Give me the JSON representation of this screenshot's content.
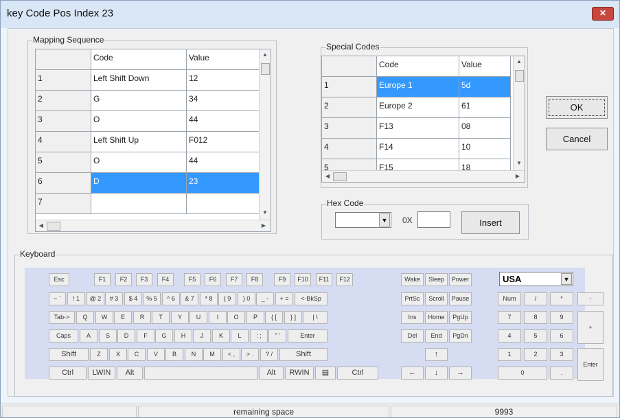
{
  "window": {
    "title": "key Code Pos Index 23",
    "close_glyph": "✕"
  },
  "mapping": {
    "legend": "Mapping Sequence",
    "headers": [
      "Code",
      "Value"
    ],
    "rows": [
      {
        "n": "1",
        "code": "Left Shift Down",
        "value": "12"
      },
      {
        "n": "2",
        "code": "G",
        "value": "34"
      },
      {
        "n": "3",
        "code": "O",
        "value": "44"
      },
      {
        "n": "4",
        "code": "Left Shift Up",
        "value": "F012"
      },
      {
        "n": "5",
        "code": "O",
        "value": "44"
      },
      {
        "n": "6",
        "code": "D",
        "value": "23"
      },
      {
        "n": "7",
        "code": "",
        "value": ""
      }
    ],
    "selected_row": 5
  },
  "special": {
    "legend": "Special Codes",
    "headers": [
      "Code",
      "Value"
    ],
    "rows": [
      {
        "n": "1",
        "code": "Europe 1",
        "value": "5d"
      },
      {
        "n": "2",
        "code": "Europe 2",
        "value": "61"
      },
      {
        "n": "3",
        "code": "F13",
        "value": "08"
      },
      {
        "n": "4",
        "code": "F14",
        "value": "10"
      },
      {
        "n": "5",
        "code": "F15",
        "value": "18"
      }
    ],
    "selected_row": 0
  },
  "buttons": {
    "ok": "OK",
    "cancel": "Cancel",
    "insert": "Insert"
  },
  "hex": {
    "legend": "Hex Code",
    "prefix": "0X",
    "combo_value": "",
    "field_value": ""
  },
  "keyboard": {
    "legend": "Keyboard",
    "layout_value": "USA",
    "keys": [
      {
        "id": "esc",
        "label": "Esc"
      },
      {
        "id": "f1",
        "label": "F1"
      },
      {
        "id": "f2",
        "label": "F2"
      },
      {
        "id": "f3",
        "label": "F3"
      },
      {
        "id": "f4",
        "label": "F4"
      },
      {
        "id": "f5",
        "label": "F5"
      },
      {
        "id": "f6",
        "label": "F6"
      },
      {
        "id": "f7",
        "label": "F7"
      },
      {
        "id": "f8",
        "label": "F8"
      },
      {
        "id": "f9",
        "label": "F9"
      },
      {
        "id": "f10",
        "label": "F10"
      },
      {
        "id": "f11",
        "label": "F11"
      },
      {
        "id": "f12",
        "label": "F12"
      },
      {
        "id": "wake",
        "label": "Wake"
      },
      {
        "id": "sleep",
        "label": "Sleep"
      },
      {
        "id": "power",
        "label": "Power"
      },
      {
        "id": "tilde",
        "label": "~ `"
      },
      {
        "id": "k1",
        "label": "! 1"
      },
      {
        "id": "k2",
        "label": "@ 2"
      },
      {
        "id": "k3",
        "label": "# 3"
      },
      {
        "id": "k4",
        "label": "$ 4"
      },
      {
        "id": "k5",
        "label": "% 5"
      },
      {
        "id": "k6",
        "label": "^ 6"
      },
      {
        "id": "k7",
        "label": "& 7"
      },
      {
        "id": "k8",
        "label": "* 8"
      },
      {
        "id": "k9",
        "label": "( 9"
      },
      {
        "id": "k0",
        "label": ") 0"
      },
      {
        "id": "minus",
        "label": "_ -"
      },
      {
        "id": "equal",
        "label": "+ ="
      },
      {
        "id": "bksp",
        "label": "<-BkSp"
      },
      {
        "id": "prtsc",
        "label": "PrtSc"
      },
      {
        "id": "scroll",
        "label": "Scroll"
      },
      {
        "id": "pause",
        "label": "Pause"
      },
      {
        "id": "num",
        "label": "Num"
      },
      {
        "id": "ndiv",
        "label": "/"
      },
      {
        "id": "nmul",
        "label": "*"
      },
      {
        "id": "nminus",
        "label": "-"
      },
      {
        "id": "tab",
        "label": "Tab->"
      },
      {
        "id": "q",
        "label": "Q"
      },
      {
        "id": "w",
        "label": "W"
      },
      {
        "id": "e",
        "label": "E"
      },
      {
        "id": "r",
        "label": "R"
      },
      {
        "id": "t",
        "label": "T"
      },
      {
        "id": "y",
        "label": "Y"
      },
      {
        "id": "u",
        "label": "U"
      },
      {
        "id": "i",
        "label": "I"
      },
      {
        "id": "o",
        "label": "O"
      },
      {
        "id": "p",
        "label": "P"
      },
      {
        "id": "lbr",
        "label": "{ ["
      },
      {
        "id": "rbr",
        "label": "} ]"
      },
      {
        "id": "bsl",
        "label": "| \\"
      },
      {
        "id": "ins",
        "label": "Ins"
      },
      {
        "id": "home",
        "label": "Home"
      },
      {
        "id": "pgup",
        "label": "PgUp"
      },
      {
        "id": "n7",
        "label": "7"
      },
      {
        "id": "n8",
        "label": "8"
      },
      {
        "id": "n9",
        "label": "9"
      },
      {
        "id": "nplus",
        "label": "+"
      },
      {
        "id": "caps",
        "label": "Caps"
      },
      {
        "id": "a",
        "label": "A"
      },
      {
        "id": "s",
        "label": "S"
      },
      {
        "id": "d",
        "label": "D"
      },
      {
        "id": "f",
        "label": "F"
      },
      {
        "id": "g",
        "label": "G"
      },
      {
        "id": "h",
        "label": "H"
      },
      {
        "id": "j",
        "label": "J"
      },
      {
        "id": "k",
        "label": "K"
      },
      {
        "id": "l",
        "label": "L"
      },
      {
        "id": "semi",
        "label": ": ;"
      },
      {
        "id": "quote",
        "label": "\" '"
      },
      {
        "id": "enter",
        "label": "Enter"
      },
      {
        "id": "del",
        "label": "Del"
      },
      {
        "id": "end",
        "label": "End"
      },
      {
        "id": "pgdn",
        "label": "PgDn"
      },
      {
        "id": "n4",
        "label": "4"
      },
      {
        "id": "n5",
        "label": "5"
      },
      {
        "id": "n6",
        "label": "6"
      },
      {
        "id": "lshift",
        "label": "Shift"
      },
      {
        "id": "z",
        "label": "Z"
      },
      {
        "id": "x",
        "label": "X"
      },
      {
        "id": "c",
        "label": "C"
      },
      {
        "id": "v",
        "label": "V"
      },
      {
        "id": "b",
        "label": "B"
      },
      {
        "id": "n",
        "label": "N"
      },
      {
        "id": "m",
        "label": "M"
      },
      {
        "id": "comma",
        "label": "< ,"
      },
      {
        "id": "period",
        "label": "> ."
      },
      {
        "id": "slash",
        "label": "? /"
      },
      {
        "id": "rshift",
        "label": "Shift"
      },
      {
        "id": "up",
        "label": "↑"
      },
      {
        "id": "n1",
        "label": "1"
      },
      {
        "id": "n2",
        "label": "2"
      },
      {
        "id": "n3",
        "label": "3"
      },
      {
        "id": "nenter",
        "label": "Enter"
      },
      {
        "id": "lctrl",
        "label": "Ctrl"
      },
      {
        "id": "lwin",
        "label": "LWIN"
      },
      {
        "id": "lalt",
        "label": "Alt"
      },
      {
        "id": "space",
        "label": ""
      },
      {
        "id": "ralt",
        "label": "Alt"
      },
      {
        "id": "rwin",
        "label": "RWIN"
      },
      {
        "id": "menu",
        "label": "▤"
      },
      {
        "id": "rctrl",
        "label": "Ctrl"
      },
      {
        "id": "left",
        "label": "←"
      },
      {
        "id": "down",
        "label": "↓"
      },
      {
        "id": "right",
        "label": "→"
      },
      {
        "id": "n0",
        "label": "0"
      },
      {
        "id": "ndot",
        "label": "."
      }
    ]
  },
  "statusbar": {
    "panel1": "",
    "panel2": "remaining space",
    "panel3": "9993"
  }
}
